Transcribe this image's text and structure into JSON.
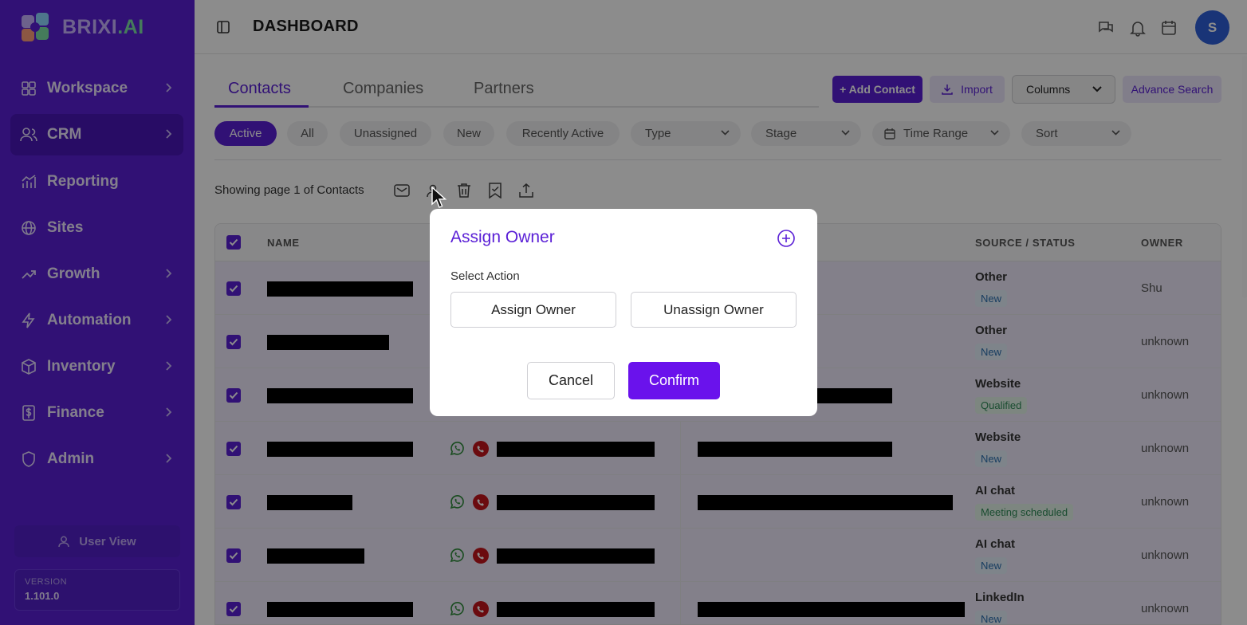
{
  "brand": {
    "name": "BRIXI",
    "suffix": ".AI"
  },
  "sidebar": {
    "items": [
      {
        "label": "Workspace",
        "icon": "grid-icon",
        "has_chevron": true
      },
      {
        "label": "CRM",
        "icon": "users-icon",
        "has_chevron": true,
        "active": true
      },
      {
        "label": "Reporting",
        "icon": "bar-chart-icon",
        "has_chevron": false
      },
      {
        "label": "Sites",
        "icon": "globe-icon",
        "has_chevron": false
      },
      {
        "label": "Growth",
        "icon": "trend-up-icon",
        "has_chevron": true
      },
      {
        "label": "Automation",
        "icon": "lightning-icon",
        "has_chevron": true
      },
      {
        "label": "Inventory",
        "icon": "box-icon",
        "has_chevron": true
      },
      {
        "label": "Finance",
        "icon": "dollar-icon",
        "has_chevron": true
      },
      {
        "label": "Admin",
        "icon": "shield-icon",
        "has_chevron": true
      }
    ],
    "user_view_label": "User View",
    "version_label": "VERSION",
    "version_value": "1.101.0"
  },
  "header": {
    "title": "DASHBOARD",
    "avatar_initial": "S"
  },
  "tabs": [
    {
      "label": "Contacts",
      "active": true
    },
    {
      "label": "Companies"
    },
    {
      "label": "Partners"
    }
  ],
  "actions": {
    "add_contact": "+ Add Contact",
    "import": "Import",
    "columns": "Columns",
    "advance_search": "Advance Search"
  },
  "filters": {
    "chips": [
      "Active",
      "All",
      "Unassigned",
      "New",
      "Recently Active"
    ],
    "dropdowns": [
      "Type",
      "Stage",
      "Time Range",
      "Sort"
    ]
  },
  "list": {
    "showing_text": "Showing page 1 of Contacts"
  },
  "table": {
    "headers": {
      "name": "NAME",
      "source_status": "SOURCE / STATUS",
      "owner": "OWNER"
    },
    "rows": [
      {
        "source": "Other",
        "status": "New",
        "owner": "Shu"
      },
      {
        "source": "Other",
        "status": "New",
        "owner": "unknown"
      },
      {
        "source": "Website",
        "status": "Qualified",
        "owner": "unknown"
      },
      {
        "source": "Website",
        "status": "New",
        "owner": "unknown"
      },
      {
        "source": "AI chat",
        "status": "Meeting scheduled",
        "owner": "unknown"
      },
      {
        "source": "AI chat",
        "status": "New",
        "owner": "unknown"
      },
      {
        "source": "LinkedIn",
        "status": "New",
        "owner": "unknown"
      }
    ]
  },
  "modal": {
    "title": "Assign Owner",
    "select_label": "Select Action",
    "assign_label": "Assign Owner",
    "unassign_label": "Unassign Owner",
    "cancel_label": "Cancel",
    "confirm_label": "Confirm"
  },
  "colors": {
    "brand_purple": "#5a1fd6",
    "confirm_purple": "#6a12ec",
    "avatar_blue": "#2f5fd9"
  }
}
